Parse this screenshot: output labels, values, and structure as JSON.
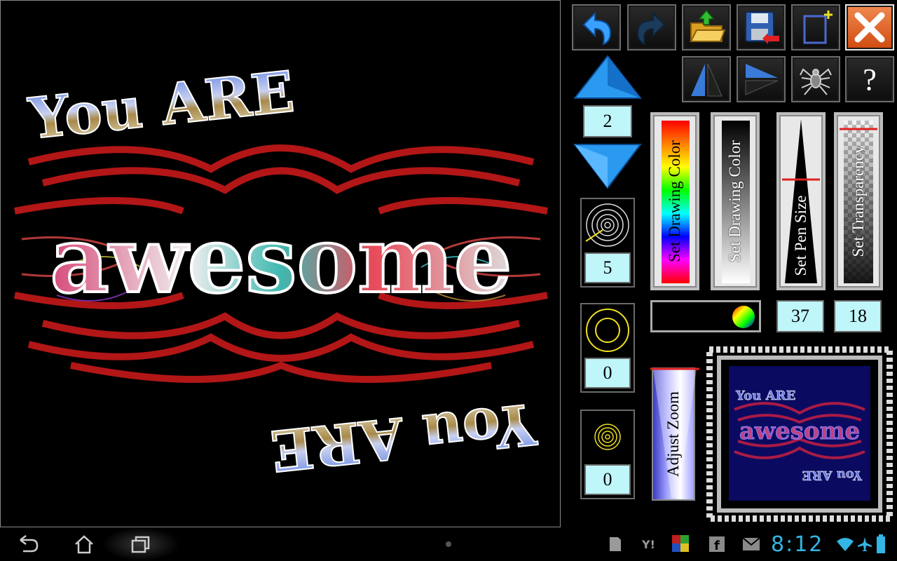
{
  "canvas": {
    "art_top": "You ARE",
    "art_center": "awesome",
    "art_bottom": "You ARE"
  },
  "toolbar": {
    "undo": "undo-arrow",
    "redo": "redo-arrow",
    "open": "open-folder",
    "save": "save-disk",
    "new": "new-canvas",
    "close": "close-x",
    "mirror_vertical": "mirror-vertical",
    "mirror_horizontal": "mirror-horizontal",
    "spider": "spider",
    "help_label": "?"
  },
  "symmetry": {
    "value": "2"
  },
  "brush_spiral": {
    "value": "5"
  },
  "brush_ring": {
    "value": "0"
  },
  "brush_dot": {
    "value": "0"
  },
  "sliders": {
    "set_drawing_color_rainbow": "Set Drawing Color",
    "set_drawing_color_gray": "Set Drawing Color",
    "set_pen_size": "Set Pen Size",
    "set_transparency": "Set Transparency",
    "adjust_zoom": "Adjust Zoom",
    "pen_size_value": "37",
    "transparency_value": "18"
  },
  "preview": {
    "text_top": "You ARE",
    "text_center": "awesome",
    "text_bottom": "You ARE"
  },
  "statusbar": {
    "time": "8:12",
    "accent": "#33b5e5"
  }
}
